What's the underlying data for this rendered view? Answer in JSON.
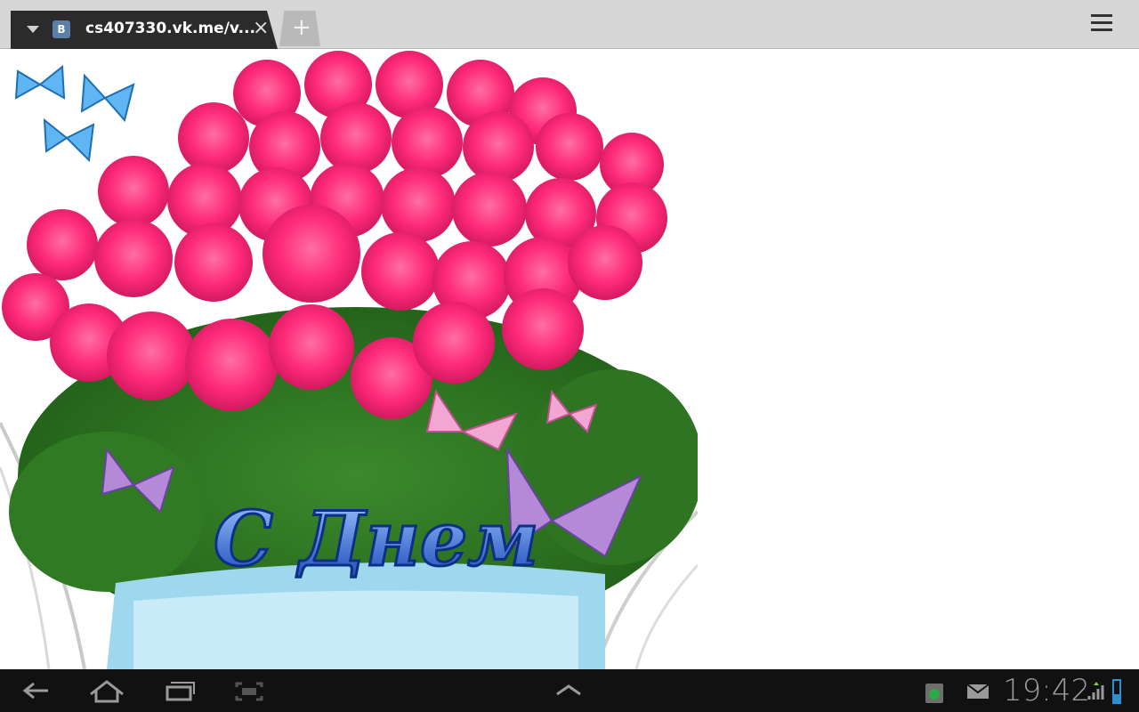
{
  "browser": {
    "tab": {
      "favicon_letter": "B",
      "title": "cs407330.vk.me/v...",
      "close_glyph": "×"
    },
    "new_tab_glyph": "+",
    "menu_icon": "overflow-menu-icon"
  },
  "content": {
    "image_text": "С Днем"
  },
  "system_bar": {
    "icons": [
      "back-icon",
      "home-icon",
      "recent-apps-icon",
      "screenshot-icon",
      "up-chevron-icon",
      "recycle-icon",
      "mail-icon",
      "signal-icon",
      "battery-icon"
    ],
    "time": "19:42",
    "colors": {
      "accent": "#ff2a78"
    }
  }
}
